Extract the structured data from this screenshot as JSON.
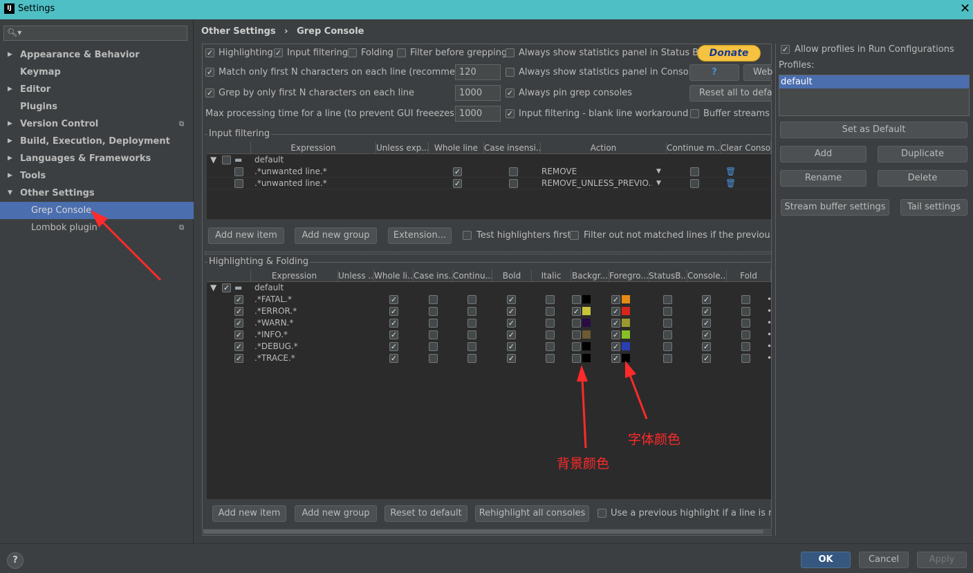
{
  "window": {
    "title": "Settings"
  },
  "sidebar": {
    "search_placeholder": "",
    "items": [
      {
        "label": "Appearance & Behavior",
        "arrow": "▶"
      },
      {
        "label": "Keymap",
        "arrow": ""
      },
      {
        "label": "Editor",
        "arrow": "▶"
      },
      {
        "label": "Plugins",
        "arrow": ""
      },
      {
        "label": "Version Control",
        "arrow": "▶"
      },
      {
        "label": "Build, Execution, Deployment",
        "arrow": "▶"
      },
      {
        "label": "Languages & Frameworks",
        "arrow": "▶"
      },
      {
        "label": "Tools",
        "arrow": "▶"
      },
      {
        "label": "Other Settings",
        "arrow": "▼"
      },
      {
        "label": "Grep Console",
        "arrow": ""
      },
      {
        "label": "Lombok plugin",
        "arrow": ""
      }
    ]
  },
  "breadcrumb": {
    "parent": "Other Settings",
    "sep": "›",
    "current": "Grep Console"
  },
  "options": {
    "highlighting": "Highlighting",
    "input_filtering": "Input filtering",
    "folding": "Folding",
    "filter_before": "Filter before grepping",
    "stats_status": "Always show statistics panel in Status Bar",
    "match_first": "Match only first N characters on each line (recommended)",
    "match_first_value": "120",
    "stats_console": "Always show statistics panel in Console",
    "grep_first": "Grep by only first N characters on each line",
    "grep_first_value": "1000",
    "pin_consoles": "Always pin grep consoles",
    "max_time": "Max processing time for a line (to prevent GUI freeezes) [ms]",
    "max_time_value": "1000",
    "blank_line": "Input filtering - blank line workaround",
    "buffer_streams": "Buffer streams",
    "donate": "Donate",
    "help": "?",
    "web": "Web",
    "reset_all": "Reset all to defaul"
  },
  "input_filtering": {
    "title": "Input filtering",
    "columns": [
      "Expression",
      "Unless exp...",
      "Whole line",
      "Case insensi...",
      "Action",
      "Continue m...",
      "Clear Conso"
    ],
    "group": "default",
    "rows": [
      {
        "expr": ".*unwanted line.*",
        "action": "REMOVE"
      },
      {
        "expr": ".*unwanted line.*",
        "action": "REMOVE_UNLESS_PREVIO..."
      }
    ],
    "add_item": "Add new item",
    "add_group": "Add new group",
    "extension": "Extension...",
    "test_first": "Test highlighters first",
    "filter_out": "Filter out not matched lines if the previous one"
  },
  "highlighting": {
    "title": "Highlighting & Folding",
    "columns": [
      "Expression",
      "Unless ...",
      "Whole li...",
      "Case ins...",
      "Continu...",
      "Bold",
      "Italic",
      "Backgr...",
      "Foregro...",
      "StatusB...",
      "Console...",
      "Fold"
    ],
    "group": "default",
    "rows": [
      {
        "expr": ".*FATAL.*",
        "bg_on": false,
        "bg": "#000000",
        "fg": "#e58a14"
      },
      {
        "expr": ".*ERROR.*",
        "bg_on": true,
        "bg": "#c8c43c",
        "fg": "#d9261b"
      },
      {
        "expr": ".*WARN.*",
        "bg_on": false,
        "bg": "#2a0b44",
        "fg": "#9c9a2f"
      },
      {
        "expr": ".*INFO.*",
        "bg_on": false,
        "bg": "#6b5a32",
        "fg": "#86c225"
      },
      {
        "expr": ".*DEBUG.*",
        "bg_on": false,
        "bg": "#000000",
        "fg": "#2a3fb3"
      },
      {
        "expr": ".*TRACE.*",
        "bg_on": false,
        "bg": "#000000",
        "fg": "#000000"
      }
    ],
    "add_item": "Add new item",
    "add_group": "Add new group",
    "reset": "Reset to default",
    "rehighlight": "Rehighlight all consoles",
    "use_previous": "Use a previous highlight if a line is not r"
  },
  "profiles": {
    "allow": "Allow profiles in Run Configurations",
    "label": "Profiles:",
    "items": [
      "default"
    ],
    "set_default": "Set as Default",
    "add": "Add",
    "duplicate": "Duplicate",
    "rename": "Rename",
    "delete": "Delete",
    "stream_buffer": "Stream buffer settings",
    "tail": "Tail settings"
  },
  "annotations": {
    "bg_label": "背景颜色",
    "fg_label": "字体颜色"
  },
  "footer": {
    "ok": "OK",
    "cancel": "Cancel",
    "apply": "Apply",
    "help": "?"
  },
  "colors": {
    "accent": "#4b6eaf",
    "titlebar": "#4ebfc5",
    "annotation": "#ff2a2a"
  }
}
